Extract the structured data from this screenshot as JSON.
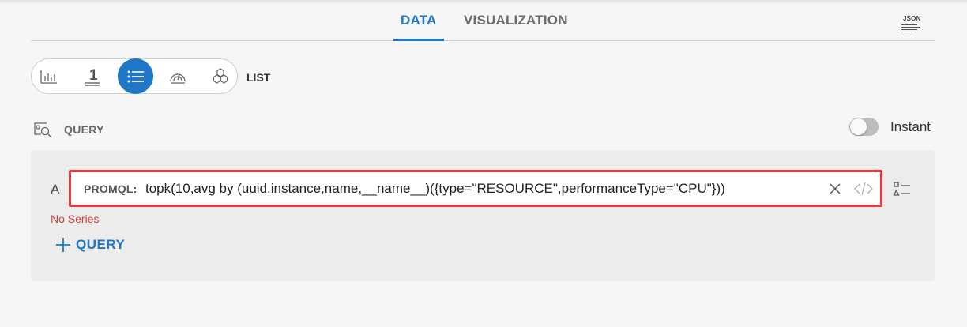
{
  "tabs": {
    "data": "DATA",
    "visualization": "VISUALIZATION",
    "json_icon_text": "JSON"
  },
  "viz": {
    "icons": [
      "bar-chart-icon",
      "single-stat-icon",
      "list-icon",
      "gauge-icon",
      "honeycomb-icon"
    ],
    "selected": "list-icon",
    "selected_label": "LIST"
  },
  "query_section": {
    "title": "QUERY",
    "instant_label": "Instant",
    "instant_on": false
  },
  "query": {
    "letter": "A",
    "prefix": "PROMQL:",
    "value": "topk(10,avg by (uuid,instance,name,__name__)({type=\"RESOURCE\",performanceType=\"CPU\"}))",
    "status": "No Series"
  },
  "add_query_label": "QUERY",
  "colors": {
    "accent": "#1f77c6",
    "error": "#d0433a",
    "highlight_border": "#e5393d"
  }
}
